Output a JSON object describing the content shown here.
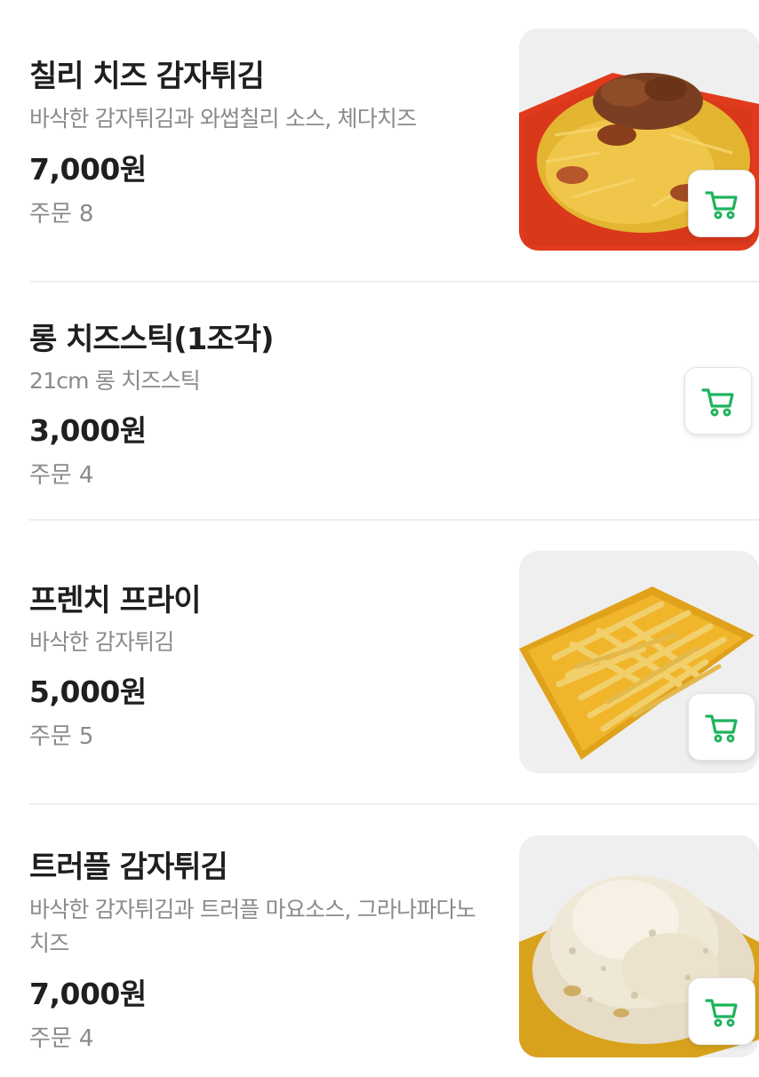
{
  "colors": {
    "accent_green": "#1fb35c",
    "price_text": "#1f1f1f",
    "secondary_text": "#8a8a8a",
    "divider": "#eeeeee"
  },
  "menu": {
    "items": [
      {
        "name": "칠리 치즈 감자튀김",
        "description": "바삭한 감자튀김과 와썹칠리 소스, 체다치즈",
        "price": "7,000원",
        "orders_label": "주문",
        "orders_count": "8",
        "image": "chili-cheese-fries-photo",
        "cart_icon": "cart-icon"
      },
      {
        "name": "롱 치즈스틱(1조각)",
        "description": "21cm 롱 치즈스틱",
        "price": "3,000원",
        "orders_label": "주문",
        "orders_count": "4",
        "cart_icon": "cart-icon"
      },
      {
        "name": "프렌치 프라이",
        "description": "바삭한 감자튀김",
        "price": "5,000원",
        "orders_label": "주문",
        "orders_count": "5",
        "image": "french-fries-photo",
        "cart_icon": "cart-icon"
      },
      {
        "name": "트러플 감자튀김",
        "description": "바삭한 감자튀김과 트러플 마요소스, 그라나파다노 치즈",
        "price": "7,000원",
        "orders_label": "주문",
        "orders_count": "4",
        "image": "truffle-fries-photo",
        "cart_icon": "cart-icon"
      }
    ]
  }
}
